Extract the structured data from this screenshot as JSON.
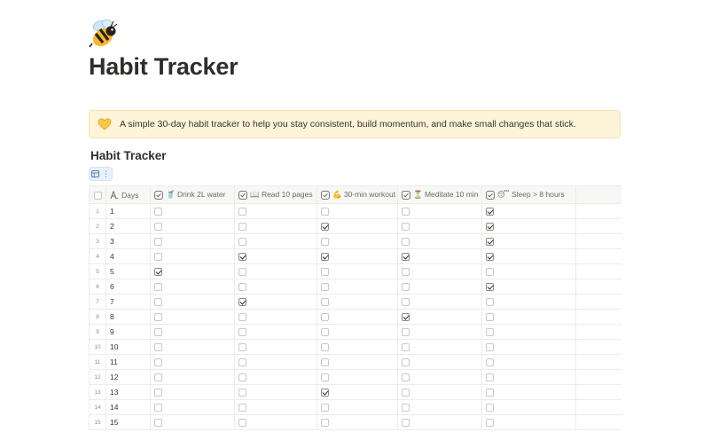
{
  "page": {
    "icon": "bee-icon",
    "title": "Habit Tracker"
  },
  "callout": {
    "icon": "yellow-heart-icon",
    "text": "A simple 30-day habit tracker to help you stay consistent, build momentum, and make small changes that stick."
  },
  "database": {
    "title": "Habit Tracker",
    "view_icon": "table-view-icon",
    "view_menu": "⋮"
  },
  "columns": [
    {
      "key": "days",
      "label": "Days",
      "icon": "text-title-icon"
    },
    {
      "key": "water",
      "label": "🥤 Drink 2L water",
      "icon": "checkbox-property-icon"
    },
    {
      "key": "read",
      "label": "📖 Read 10 pages",
      "icon": "checkbox-property-icon"
    },
    {
      "key": "workout",
      "label": "💪 30-min workout",
      "icon": "checkbox-property-icon"
    },
    {
      "key": "meditate",
      "label": "⏳ Meditate 10 min",
      "icon": "checkbox-property-icon"
    },
    {
      "key": "sleep",
      "label": "😴 Sleep > 8 hours",
      "icon": "checkbox-property-icon"
    }
  ],
  "rows": [
    {
      "num": "1",
      "day": "1",
      "water": false,
      "read": false,
      "workout": false,
      "meditate": false,
      "sleep": true
    },
    {
      "num": "2",
      "day": "2",
      "water": false,
      "read": false,
      "workout": true,
      "meditate": false,
      "sleep": true
    },
    {
      "num": "3",
      "day": "3",
      "water": false,
      "read": false,
      "workout": false,
      "meditate": false,
      "sleep": true
    },
    {
      "num": "4",
      "day": "4",
      "water": false,
      "read": true,
      "workout": true,
      "meditate": true,
      "sleep": true
    },
    {
      "num": "5",
      "day": "5",
      "water": true,
      "read": false,
      "workout": false,
      "meditate": false,
      "sleep": false
    },
    {
      "num": "6",
      "day": "6",
      "water": false,
      "read": false,
      "workout": false,
      "meditate": false,
      "sleep": true
    },
    {
      "num": "7",
      "day": "7",
      "water": false,
      "read": true,
      "workout": false,
      "meditate": false,
      "sleep": false
    },
    {
      "num": "8",
      "day": "8",
      "water": false,
      "read": false,
      "workout": false,
      "meditate": true,
      "sleep": false
    },
    {
      "num": "9",
      "day": "9",
      "water": false,
      "read": false,
      "workout": false,
      "meditate": false,
      "sleep": false
    },
    {
      "num": "10",
      "day": "10",
      "water": false,
      "read": false,
      "workout": false,
      "meditate": false,
      "sleep": false
    },
    {
      "num": "11",
      "day": "11",
      "water": false,
      "read": false,
      "workout": false,
      "meditate": false,
      "sleep": false
    },
    {
      "num": "12",
      "day": "12",
      "water": false,
      "read": false,
      "workout": false,
      "meditate": false,
      "sleep": false
    },
    {
      "num": "13",
      "day": "13",
      "water": false,
      "read": false,
      "workout": true,
      "meditate": false,
      "sleep": false
    },
    {
      "num": "14",
      "day": "14",
      "water": false,
      "read": false,
      "workout": false,
      "meditate": false,
      "sleep": false
    },
    {
      "num": "15",
      "day": "15",
      "water": false,
      "read": false,
      "workout": false,
      "meditate": false,
      "sleep": false
    }
  ],
  "colors": {
    "callout_bg": "#fdf4d9",
    "view_tab_bg": "#e9f1fb",
    "header_bg": "#f7f7f5"
  }
}
